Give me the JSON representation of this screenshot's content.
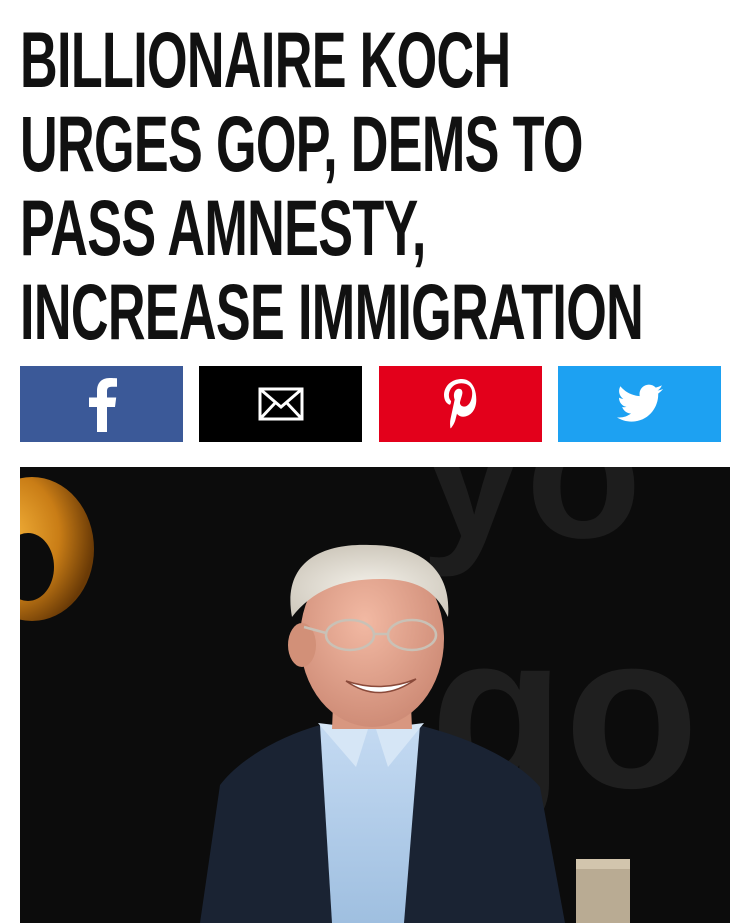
{
  "article": {
    "headline_lines": [
      "BILLIONAIRE KOCH",
      "URGES GOP, DEMS TO",
      "PASS AMNESTY,",
      "INCREASE IMMIGRATION"
    ]
  },
  "share_bar": {
    "buttons": [
      {
        "id": "facebook",
        "icon": "facebook-icon",
        "color": "#3b5998"
      },
      {
        "id": "email",
        "icon": "envelope-icon",
        "color": "#000000"
      },
      {
        "id": "pinterest",
        "icon": "pinterest-icon",
        "color": "#e3001b"
      },
      {
        "id": "twitter",
        "icon": "twitter-bird-icon",
        "color": "#1da1f2"
      }
    ]
  },
  "hero_image": {
    "subject": "smiling man in dark blazer on stage",
    "background_letters": "yo go"
  }
}
